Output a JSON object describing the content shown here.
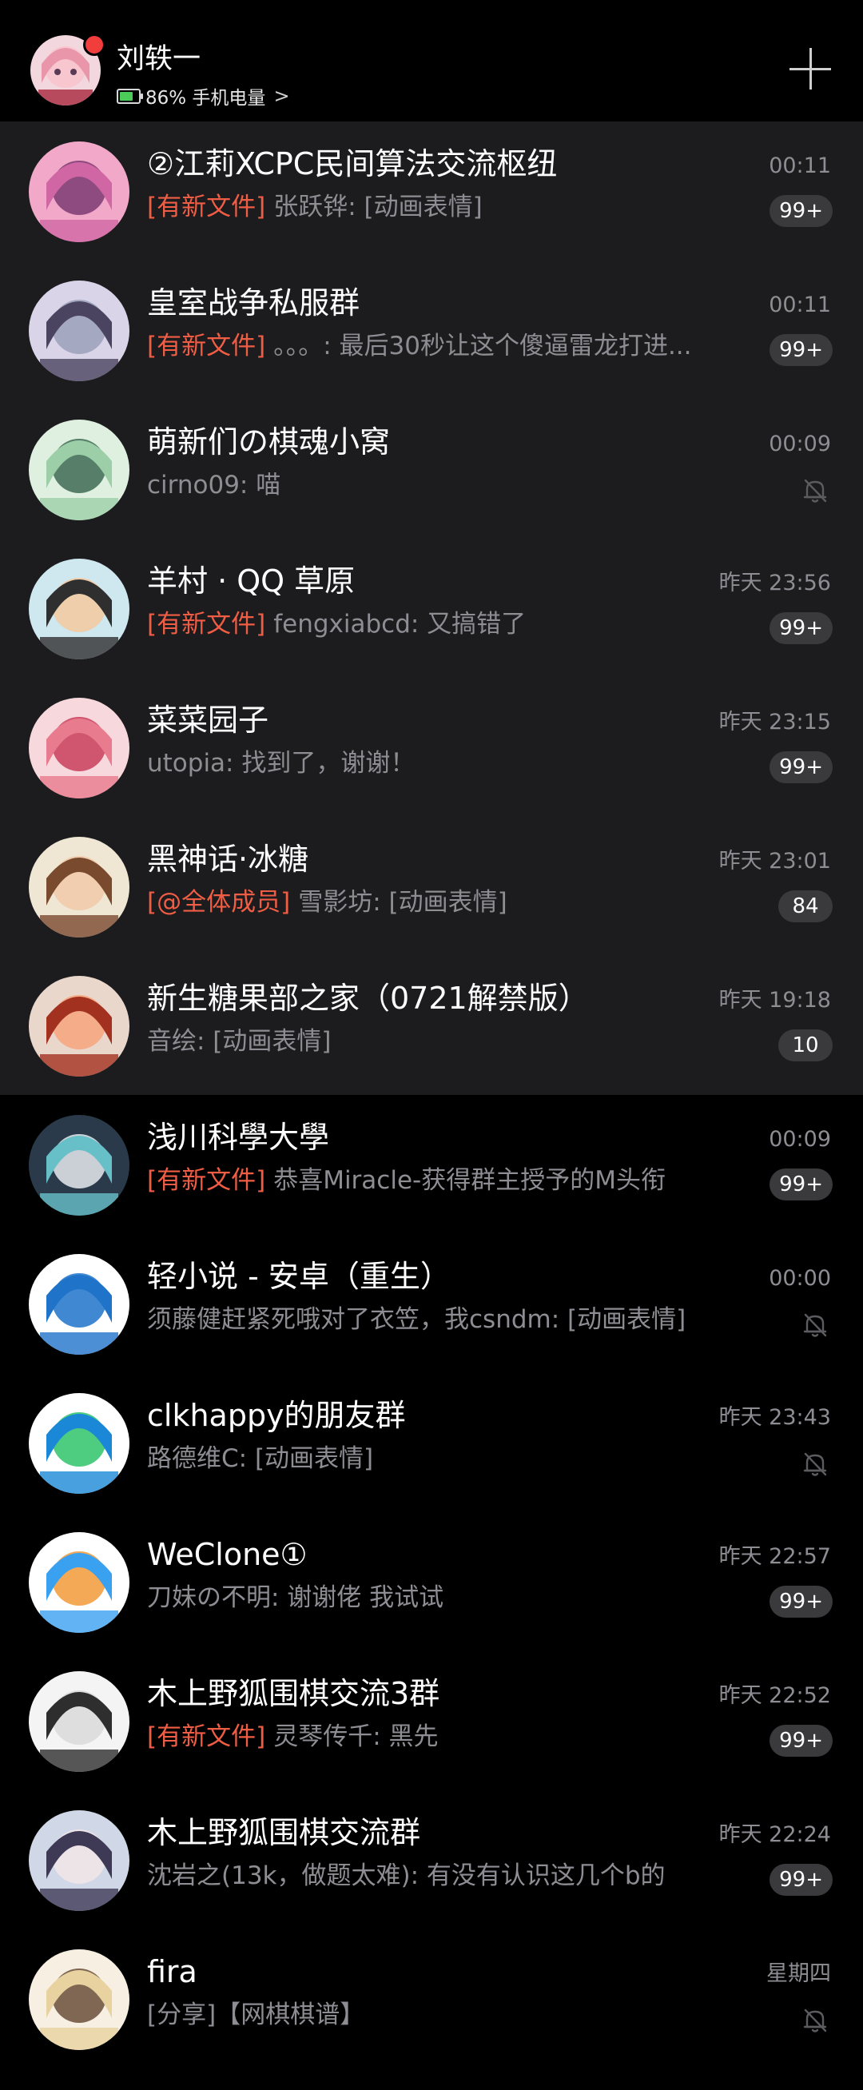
{
  "header": {
    "user_name": "刘轶一",
    "battery_text": "86% 手机电量",
    "battery_level": 0.86,
    "chevron": ">",
    "colors": {
      "battery_fill": "#4ccd5a",
      "notify_dot": "#f23d3d"
    },
    "icons": [
      "avatar",
      "battery-icon",
      "chevron-right-icon",
      "plus-icon"
    ]
  },
  "colors": {
    "tag": "#ef5d45",
    "pinned_bg": "#1c1c1e",
    "badge_bg": "#3a3a3c"
  },
  "chats": [
    {
      "title": "②江莉XCPC民间算法交流枢纽",
      "tag": "[有新文件]",
      "preview": "张跃铧: [动画表情]",
      "time": "00:11",
      "badge": "99+",
      "pinned": true
    },
    {
      "title": "皇室战争私服群",
      "tag": "[有新文件]",
      "preview": "。。。: 最后30秒让这个傻逼雷龙打进...",
      "time": "00:11",
      "badge": "99+",
      "pinned": true
    },
    {
      "title": "萌新们の棋魂小窝",
      "tag": "",
      "preview": "cirno09: 喵",
      "time": "00:09",
      "badge": "",
      "muted": true,
      "pinned": true
    },
    {
      "title": "羊村 · QQ 草原",
      "tag": "[有新文件]",
      "preview": "fengxiabcd: 又搞错了",
      "time": "昨天 23:56",
      "badge": "99+",
      "pinned": true
    },
    {
      "title": "菜菜园子",
      "tag": "",
      "preview": "utopia: 找到了，谢谢！",
      "time": "昨天 23:15",
      "badge": "99+",
      "pinned": true
    },
    {
      "title": "黑神话·冰糖",
      "tag": "[@全体成员]",
      "preview": "雪影坊: [动画表情]",
      "time": "昨天 23:01",
      "badge": "84",
      "pinned": true
    },
    {
      "title": "新生糖果部之家（0721解禁版）",
      "tag": "",
      "preview": "音绘: [动画表情]",
      "time": "昨天 19:18",
      "badge": "10",
      "pinned": true
    },
    {
      "title": "浅川科學大學",
      "tag": "[有新文件]",
      "preview": "恭喜Miracle-获得群主授予的M头衔",
      "time": "00:09",
      "badge": "99+",
      "pinned": false
    },
    {
      "title": "轻小说 - 安卓（重生）",
      "tag": "",
      "preview": "须藤健赶紧死哦对了衣笠，我csndm: [动画表情]",
      "time": "00:00",
      "badge": "",
      "muted": true,
      "pinned": false
    },
    {
      "title": "clkhappy的朋友群",
      "tag": "",
      "preview": "路德维C: [动画表情]",
      "time": "昨天 23:43",
      "badge": "",
      "muted": true,
      "pinned": false
    },
    {
      "title": "WeClone①",
      "tag": "",
      "preview": "刀妹の不明: 谢谢佬 我试试",
      "time": "昨天 22:57",
      "badge": "99+",
      "pinned": false
    },
    {
      "title": "木上野狐围棋交流3群",
      "tag": "[有新文件]",
      "preview": "灵琴传千: 黑先",
      "time": "昨天 22:52",
      "badge": "99+",
      "pinned": false
    },
    {
      "title": "木上野狐围棋交流群",
      "tag": "",
      "preview": "沈岩之(13k，做题太难): 有没有认识这几个b的",
      "time": "昨天 22:24",
      "badge": "99+",
      "pinned": false
    },
    {
      "title": "fira",
      "tag": "",
      "preview": "[分享]【网棋棋谱】",
      "time": "星期四",
      "badge": "",
      "muted": true,
      "pinned": false
    }
  ]
}
